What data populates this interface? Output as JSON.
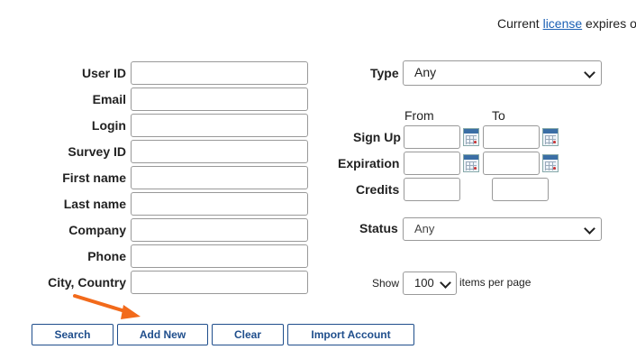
{
  "license": {
    "prefix": "Current ",
    "link": "license",
    "suffix": " expires o"
  },
  "fields": {
    "user_id": "User ID",
    "email": "Email",
    "login": "Login",
    "survey_id": "Survey ID",
    "first_name": "First name",
    "last_name": "Last name",
    "company": "Company",
    "phone": "Phone",
    "city_country": "City, Country"
  },
  "type": {
    "label": "Type",
    "value": "Any"
  },
  "dates": {
    "from": "From",
    "to": "To",
    "sign_up": "Sign Up",
    "expiration": "Expiration",
    "credits": "Credits"
  },
  "status": {
    "label": "Status",
    "value": "Any"
  },
  "paging": {
    "show": "Show",
    "value": "100",
    "items_per_page": "items per page"
  },
  "buttons": {
    "search": "Search",
    "add_new": "Add New",
    "clear": "Clear",
    "import": "Import Account"
  },
  "colors": {
    "accent": "#1f4e8c",
    "link": "#1a5fb4",
    "arrow": "#f26a1b"
  }
}
